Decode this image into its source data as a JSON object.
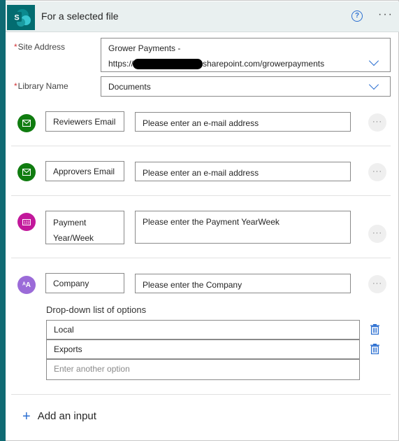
{
  "header": {
    "title": "For a selected file",
    "icons": {
      "app": "sharepoint-icon",
      "help": "help-icon",
      "more": "more-icon"
    }
  },
  "fields": {
    "site_address": {
      "label": "Site Address",
      "value_line1": "Grower Payments -",
      "value_line2_prefix": "https://",
      "value_line2_suffix": "sharepoint.com/growerpayments"
    },
    "library_name": {
      "label": "Library Name",
      "value": "Documents"
    }
  },
  "inputs": [
    {
      "name": "Reviewers  Email",
      "placeholder": "Please enter an e-mail address",
      "icon": "mail-icon",
      "color": "#107c10"
    },
    {
      "name": "Approvers Email",
      "placeholder": "Please enter an e-mail address",
      "icon": "mail-icon",
      "color": "#107c10"
    },
    {
      "name_line1": "Payment",
      "name_line2": "Year/Week",
      "placeholder": "Please enter the Payment YearWeek",
      "icon": "number-icon",
      "color": "#c2189b"
    },
    {
      "name": "Company",
      "placeholder": "Please enter the Company",
      "icon": "text-icon",
      "color": "#9b6bd8"
    }
  ],
  "dropdown": {
    "title": "Drop-down list of options",
    "options": [
      "Local",
      "Exports"
    ],
    "placeholder": "Enter another option"
  },
  "add_input": {
    "label": "Add an input"
  },
  "colors": {
    "accent": "#2b6fd1",
    "header_bg": "#e9f0f0",
    "sidebar": "#0f6a73",
    "required": "#d13438"
  }
}
